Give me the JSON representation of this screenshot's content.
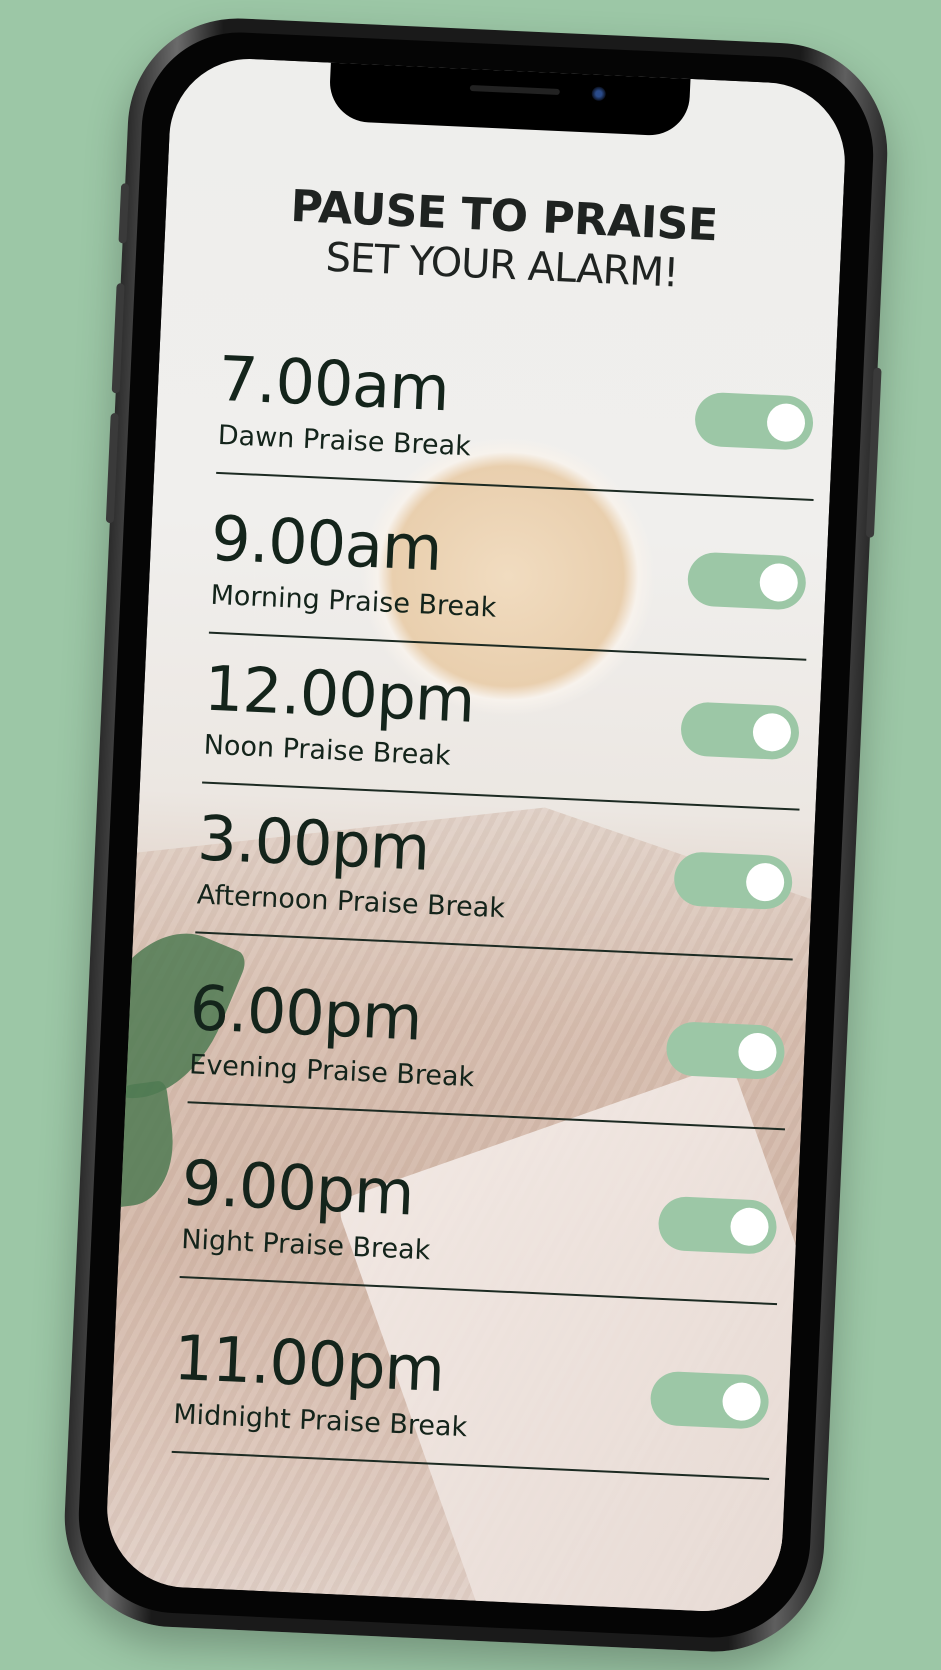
{
  "header": {
    "title": "PAUSE TO PRAISE",
    "subtitle": "SET YOUR ALARM!"
  },
  "alarms": [
    {
      "time": "7.00am",
      "label": "Dawn Praise Break",
      "enabled": true
    },
    {
      "time": "9.00am",
      "label": "Morning Praise Break",
      "enabled": true
    },
    {
      "time": "12.00pm",
      "label": "Noon Praise Break",
      "enabled": true
    },
    {
      "time": "3.00pm",
      "label": "Afternoon Praise Break",
      "enabled": true
    },
    {
      "time": "6.00pm",
      "label": "Evening Praise Break",
      "enabled": true
    },
    {
      "time": "9.00pm",
      "label": "Night Praise Break",
      "enabled": true
    },
    {
      "time": "11.00pm",
      "label": "Midnight Praise Break",
      "enabled": true
    }
  ],
  "colors": {
    "background": "#9cc7a6",
    "toggle_on": "#9cc7a6",
    "text": "#14241b"
  }
}
